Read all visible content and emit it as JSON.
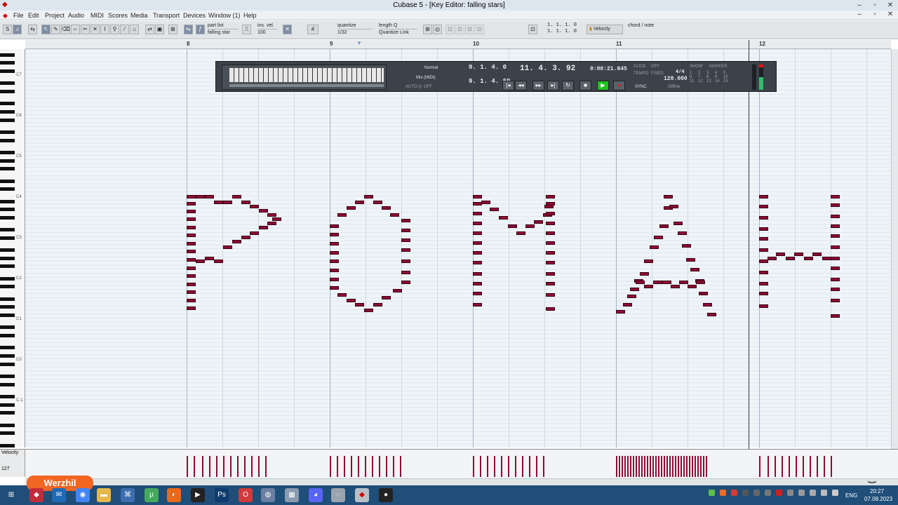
{
  "window": {
    "title": "Cubase 5 - [Key Editor: falling stars]"
  },
  "menu": [
    "File",
    "Edit",
    "Project",
    "Audio",
    "MIDI",
    "Scores",
    "Media",
    "Transport",
    "Devices",
    "Window (1)",
    "Help"
  ],
  "toolbar": {
    "part_list_label": "part list",
    "part_list_value": "falling star",
    "ins_vel_label": "ins. vel.",
    "ins_vel_value": "100",
    "quantize_label": "quantize",
    "quantize_value": "1/32",
    "length_label": "length Q",
    "length_value": "Quantize Link",
    "mouse_pos_1": "1. 1. 1.   0",
    "mouse_pos_2": "1. 1. 1.   0",
    "controller_lane": "Velocity",
    "chord_label": "chord / note"
  },
  "ruler": {
    "bars": [
      "8",
      "9",
      "10",
      "11",
      "12"
    ]
  },
  "piano": {
    "octaves": [
      "C7",
      "C6",
      "C5",
      "C4",
      "C3",
      "C2",
      "C1",
      "C0",
      "C-1"
    ]
  },
  "lanes": {
    "velocity_label": "Velocity",
    "velocity_max": "127"
  },
  "transport": {
    "mode_normal": "Normal",
    "mode_mix": "Mix (MIDI)",
    "auto_q": "AUTO Q",
    "auto_q_state": "OFF",
    "left_locator": "9. 1. 4.   0",
    "right_locator": "9. 1. 4.  60",
    "position_bars": "11. 4. 3.  92",
    "position_time": "0:00:21.845",
    "click_label": "CLICK",
    "click_state": "OFF",
    "tempo_label": "TEMPO",
    "tempo_mode": "FIXED",
    "signature": "4/4",
    "tempo_value": "120.000",
    "sync_label": "SYNC",
    "sync_state": "Offline",
    "show_label": "SHOW",
    "marker_label": "MARKER",
    "markers": [
      "1",
      "2",
      "3",
      "4",
      "5",
      "6",
      "7",
      "8",
      "9",
      "10",
      "11",
      "12",
      "13",
      "14",
      "15"
    ]
  },
  "taskbar": {
    "watermark": "Werzhil",
    "lang": "ENG",
    "time": "20:27",
    "date": "07.08.2023"
  }
}
